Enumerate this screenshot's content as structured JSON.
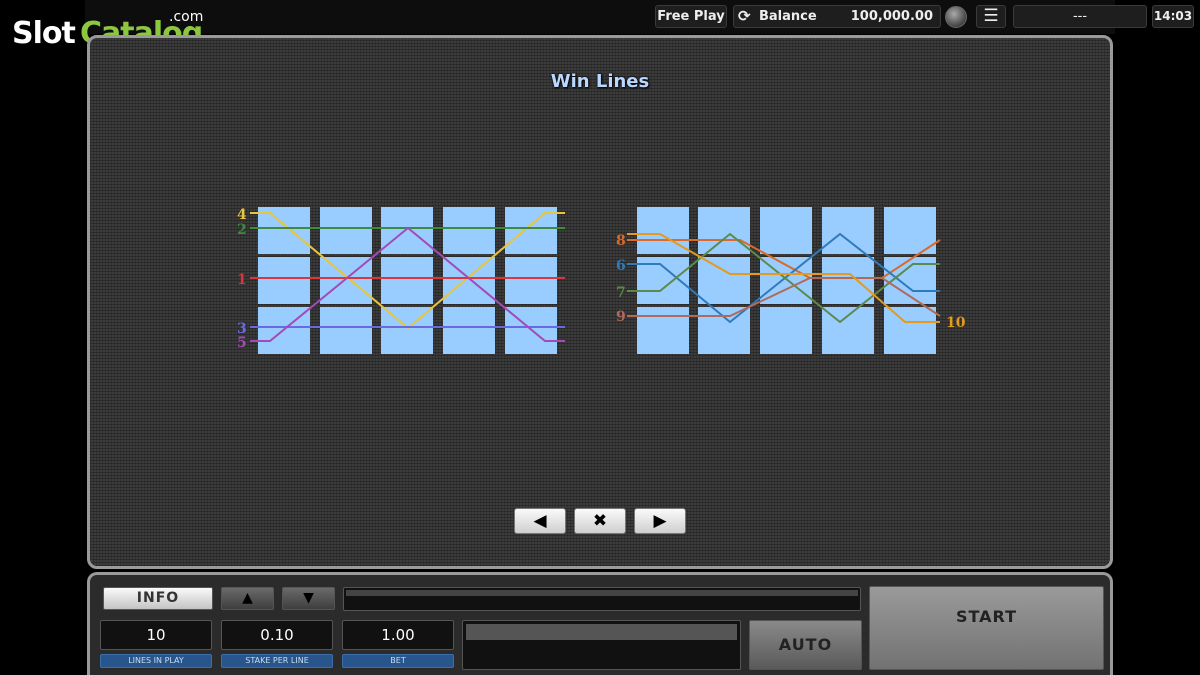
{
  "logo": {
    "slot": "Slot",
    "catalog": "Catalog",
    "com": ".com"
  },
  "topbar": {
    "free_play": "Free Play",
    "balance_label": "Balance",
    "balance_value": "100,000.00",
    "message": "---",
    "clock": "14:03",
    "menu_icon": "☰",
    "refresh_icon": "⟳"
  },
  "screen": {
    "title": "Win Lines",
    "grid_color": "#99ccff",
    "left_grid_lines": [
      {
        "number": "4",
        "color": "#e8c53a"
      },
      {
        "number": "2",
        "color": "#3e8a3e"
      },
      {
        "number": "1",
        "color": "#d9363e"
      },
      {
        "number": "3",
        "color": "#6a6adf"
      },
      {
        "number": "5",
        "color": "#a34ab8"
      }
    ],
    "right_grid_lines": [
      {
        "number": "8",
        "color": "#d96a2a"
      },
      {
        "number": "6",
        "color": "#2f7ab8"
      },
      {
        "number": "7",
        "color": "#5c8a4a"
      },
      {
        "number": "9",
        "color": "#b06a5a"
      },
      {
        "number": "10",
        "color": "#e39a1f"
      }
    ],
    "nav": {
      "prev": "◀",
      "close": "✖",
      "next": "▶"
    }
  },
  "controls": {
    "info": "INFO",
    "up": "▲",
    "down": "▼",
    "lines_value": "10",
    "lines_label": "LINES IN PLAY",
    "stake_value": "0.10",
    "stake_label": "STAKE PER LINE",
    "bet_value": "1.00",
    "bet_label": "BET",
    "auto": "AUTO",
    "start": "START"
  }
}
